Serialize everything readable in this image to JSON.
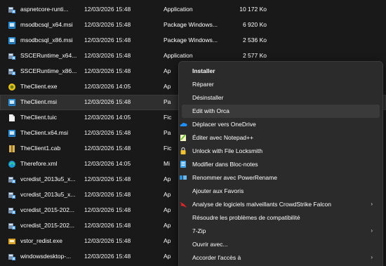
{
  "files": [
    {
      "name": "aspnetcore-runti...",
      "date": "12/03/2026 15:48",
      "type": "Application",
      "size": "10 172 Ko",
      "icon": "installer-setup-icon"
    },
    {
      "name": "msodbcsql_x64.msi",
      "date": "12/03/2026 15:48",
      "type": "Package Windows...",
      "size": "6 920 Ko",
      "icon": "msi-package-icon"
    },
    {
      "name": "msodbcsql_x86.msi",
      "date": "12/03/2026 15:48",
      "type": "Package Windows...",
      "size": "2 536 Ko",
      "icon": "msi-package-icon"
    },
    {
      "name": "SSCERuntime_x64...",
      "date": "12/03/2026 15:48",
      "type": "Application",
      "size": "2 577 Ko",
      "icon": "installer-setup-icon"
    },
    {
      "name": "SSCERuntime_x86...",
      "date": "12/03/2026 15:48",
      "type": "Ap",
      "size": "",
      "icon": "installer-setup-icon"
    },
    {
      "name": "TheClient.exe",
      "date": "12/03/2026 14:05",
      "type": "Ap",
      "size": "",
      "icon": "app-exe-icon"
    },
    {
      "name": "TheClient.msi",
      "date": "12/03/2026 15:48",
      "type": "Pa",
      "size": "",
      "icon": "msi-package-icon"
    },
    {
      "name": "TheClient.tuic",
      "date": "12/03/2026 14:05",
      "type": "Fic",
      "size": "",
      "icon": "blank-file-icon"
    },
    {
      "name": "TheClient.x64.msi",
      "date": "12/03/2026 15:48",
      "type": "Pa",
      "size": "",
      "icon": "msi-package-icon"
    },
    {
      "name": "TheClient1.cab",
      "date": "12/03/2026 15:48",
      "type": "Fic",
      "size": "",
      "icon": "cab-archive-icon"
    },
    {
      "name": "Therefore.xml",
      "date": "12/03/2026 14:05",
      "type": "Mi",
      "size": "",
      "icon": "edge-xml-icon"
    },
    {
      "name": "vcredist_2013u5_x...",
      "date": "12/03/2026 15:48",
      "type": "Ap",
      "size": "",
      "icon": "installer-setup-icon"
    },
    {
      "name": "vcredist_2013u5_x...",
      "date": "12/03/2026 15:48",
      "type": "Ap",
      "size": "",
      "icon": "installer-setup-icon"
    },
    {
      "name": "vcredist_2015-202...",
      "date": "12/03/2026 15:48",
      "type": "Ap",
      "size": "",
      "icon": "installer-setup-icon"
    },
    {
      "name": "vcredist_2015-202...",
      "date": "12/03/2026 15:48",
      "type": "Ap",
      "size": "",
      "icon": "installer-setup-icon"
    },
    {
      "name": "vstor_redist.exe",
      "date": "12/03/2026 15:48",
      "type": "Ap",
      "size": "",
      "icon": "vstor-setup-icon"
    },
    {
      "name": "windowsdesktop-...",
      "date": "12/03/2026 15:48",
      "type": "Ap",
      "size": "",
      "icon": "installer-setup-icon"
    }
  ],
  "menu": [
    {
      "label": "Installer",
      "bold": true,
      "icon": "",
      "submenu": false
    },
    {
      "label": "Réparer",
      "icon": "",
      "submenu": false
    },
    {
      "label": "Désinstaller",
      "icon": "",
      "submenu": false
    },
    {
      "label": "Edit with Orca",
      "icon": "",
      "submenu": false,
      "hover": true
    },
    {
      "label": "Déplacer vers OneDrive",
      "icon": "onedrive-cloud-icon",
      "submenu": false
    },
    {
      "label": "Éditer avec Notepad++",
      "icon": "notepadplusplus-icon",
      "submenu": false
    },
    {
      "label": "Unlock with File Locksmith",
      "icon": "lock-icon",
      "submenu": false
    },
    {
      "label": "Modifier dans Bloc-notes",
      "icon": "notepad-icon",
      "submenu": false
    },
    {
      "label": "Renommer avec PowerRename",
      "icon": "powerrename-icon",
      "submenu": false
    },
    {
      "label": "Ajouter aux Favoris",
      "icon": "",
      "submenu": false
    },
    {
      "label": "Analyse de logiciels malveillants CrowdStrike Falcon",
      "icon": "crowdstrike-falcon-icon",
      "submenu": true
    },
    {
      "label": "Résoudre les problèmes de compatibilité",
      "icon": "",
      "submenu": false
    },
    {
      "label": "7-Zip",
      "icon": "",
      "submenu": true
    },
    {
      "label": "Ouvrir avec...",
      "icon": "",
      "submenu": false
    },
    {
      "label": "Accorder l'accès à",
      "icon": "",
      "submenu": true
    }
  ],
  "selected_index": 6,
  "submenu_arrow": "›",
  "colors": {
    "background": "#191919",
    "menu": "#2b2b2b",
    "selected": "#2f2f2f",
    "accent": "#0078d4"
  }
}
